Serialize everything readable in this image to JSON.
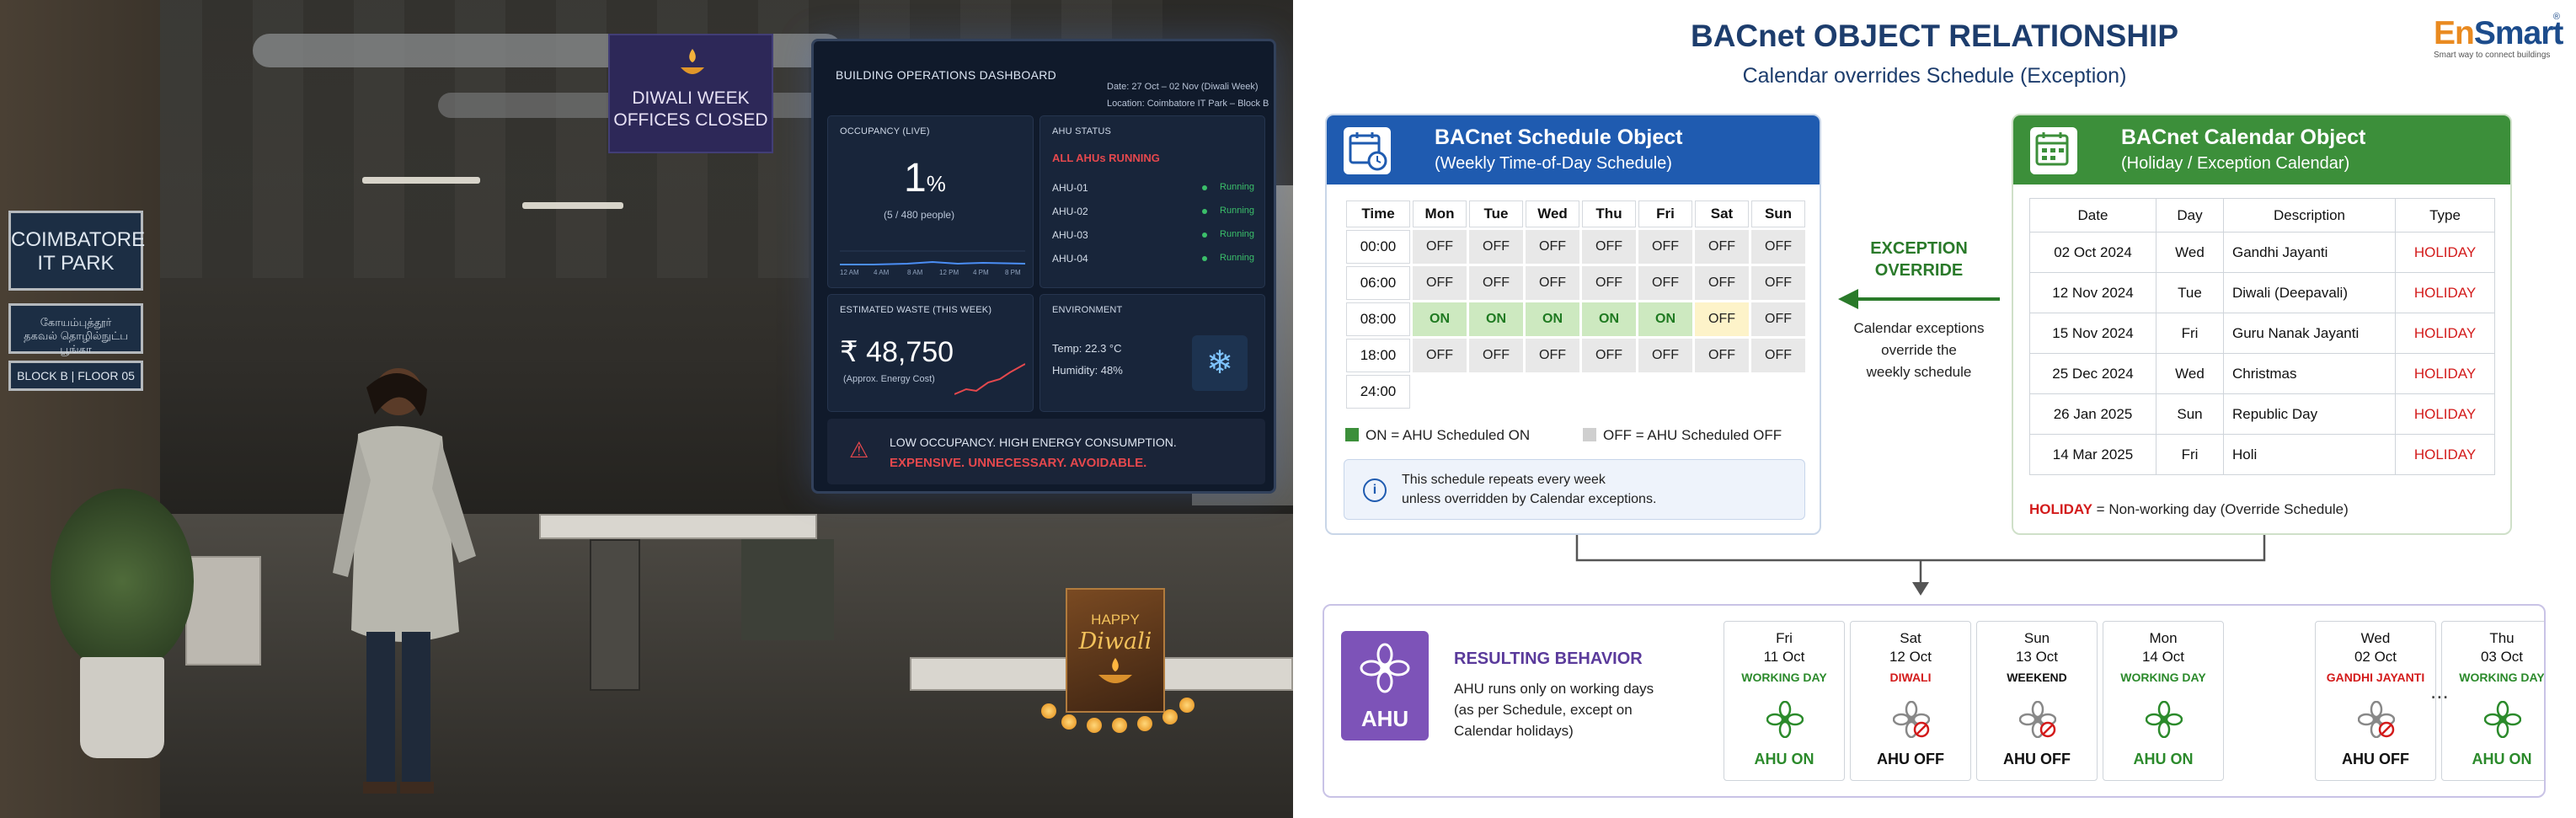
{
  "photo": {
    "sign_coimbatore": [
      "COIMBATORE",
      "IT PARK"
    ],
    "sign_tamil": [
      "கோயம்புத்தூர்",
      "தகவல் தொழில்நுட்ப பூங்கா"
    ],
    "sign_floor": "BLOCK B | FLOOR 05",
    "banner": [
      "DIWALI WEEK",
      "OFFICES CLOSED"
    ],
    "diwali_card": {
      "line1": "HAPPY",
      "line2": "Diwali"
    },
    "dashboard": {
      "title": "BUILDING OPERATIONS DASHBOARD",
      "date": "Date: 27 Oct – 02 Nov (Diwali Week)",
      "location": "Location: Coimbatore IT Park – Block B",
      "occupancy": {
        "label": "OCCUPANCY (LIVE)",
        "value": "1",
        "unit": "%",
        "sub": "(5 / 480 people)",
        "axis": [
          "12 AM",
          "4 AM",
          "8 AM",
          "12 PM",
          "4 PM",
          "8 PM"
        ]
      },
      "ahu": {
        "label": "AHU STATUS",
        "all": "ALL AHUs RUNNING",
        "units": [
          "AHU-01",
          "AHU-02",
          "AHU-03",
          "AHU-04"
        ],
        "state": "Running"
      },
      "waste": {
        "label": "ESTIMATED WASTE (THIS WEEK)",
        "value": "₹ 48,750",
        "sub": "(Approx. Energy Cost)"
      },
      "env": {
        "label": "ENVIRONMENT",
        "temp": "Temp: 22.3 °C",
        "humidity": "Humidity: 48%"
      },
      "alert": {
        "line1": "LOW OCCUPANCY. HIGH ENERGY CONSUMPTION.",
        "line2": "EXPENSIVE. UNNECESSARY. AVOIDABLE."
      }
    }
  },
  "info": {
    "title": "BACnet OBJECT RELATIONSHIP",
    "subtitle": "Calendar overrides Schedule (Exception)",
    "logo": {
      "en": "En",
      "smart": "Smart",
      "tagline": "Smart way to connect buildings",
      "reg": "®"
    },
    "schedule": {
      "title": "BACnet Schedule Object",
      "subtitle": "(Weekly Time-of-Day Schedule)",
      "columns": [
        "Time",
        "Mon",
        "Tue",
        "Wed",
        "Thu",
        "Fri",
        "Sat",
        "Sun"
      ],
      "rows": [
        {
          "time": "00:00",
          "cells": [
            "OFF",
            "OFF",
            "OFF",
            "OFF",
            "OFF",
            "OFF",
            "OFF"
          ]
        },
        {
          "time": "06:00",
          "cells": [
            "OFF",
            "OFF",
            "OFF",
            "OFF",
            "OFF",
            "OFF",
            "OFF"
          ]
        },
        {
          "time": "08:00",
          "cells": [
            "ON",
            "ON",
            "ON",
            "ON",
            "ON",
            "OFF",
            "OFF"
          ]
        },
        {
          "time": "18:00",
          "cells": [
            "OFF",
            "OFF",
            "OFF",
            "OFF",
            "OFF",
            "OFF",
            "OFF"
          ]
        },
        {
          "time": "24:00",
          "cells": []
        }
      ],
      "legend_on": "ON = AHU Scheduled ON",
      "legend_off": "OFF = AHU Scheduled OFF",
      "note": [
        "This schedule repeats every week",
        "unless overridden by Calendar exceptions."
      ],
      "colors": {
        "header": "#1f5bb0",
        "on": "#cde9c0",
        "off": "#e8e8e8"
      }
    },
    "exception": {
      "title": [
        "EXCEPTION",
        "OVERRIDE"
      ],
      "desc": [
        "Calendar exceptions",
        "override the",
        "weekly schedule"
      ]
    },
    "calendar": {
      "title": "BACnet Calendar Object",
      "subtitle": "(Holiday / Exception Calendar)",
      "columns": [
        "Date",
        "Day",
        "Description",
        "Type"
      ],
      "rows": [
        [
          "02 Oct 2024",
          "Wed",
          "Gandhi Jayanti",
          "HOLIDAY"
        ],
        [
          "12 Nov 2024",
          "Tue",
          "Diwali (Deepavali)",
          "HOLIDAY"
        ],
        [
          "15 Nov 2024",
          "Fri",
          "Guru Nanak Jayanti",
          "HOLIDAY"
        ],
        [
          "25 Dec 2024",
          "Wed",
          "Christmas",
          "HOLIDAY"
        ],
        [
          "26 Jan 2025",
          "Sun",
          "Republic Day",
          "HOLIDAY"
        ],
        [
          "14 Mar 2025",
          "Fri",
          "Holi",
          "HOLIDAY"
        ]
      ],
      "legend_key": "HOLIDAY",
      "legend_text": " = Non-working day (Override Schedule)",
      "colors": {
        "header": "#3c8f3a",
        "holiday": "#d31b1b"
      }
    },
    "result": {
      "icon_label": "AHU",
      "title": "RESULTING BEHAVIOR",
      "desc": [
        "AHU runs only on working days",
        "(as per Schedule, except on",
        "Calendar holidays)"
      ],
      "ellipsis": "...",
      "days": [
        {
          "day": "Fri",
          "date": "11 Oct",
          "status": "WORKING DAY",
          "ahu": "AHU ON",
          "on": true
        },
        {
          "day": "Sat",
          "date": "12 Oct",
          "status": "DIWALI",
          "ahu": "AHU OFF",
          "on": false
        },
        {
          "day": "Sun",
          "date": "13 Oct",
          "status": "WEEKEND",
          "ahu": "AHU OFF",
          "on": false
        },
        {
          "day": "Mon",
          "date": "14 Oct",
          "status": "WORKING DAY",
          "ahu": "AHU ON",
          "on": true
        },
        {
          "day": "Wed",
          "date": "02 Oct",
          "status": "GANDHI JAYANTI",
          "ahu": "AHU OFF",
          "on": false
        },
        {
          "day": "Thu",
          "date": "03 Oct",
          "status": "WORKING DAY",
          "ahu": "AHU ON",
          "on": true
        }
      ]
    }
  }
}
